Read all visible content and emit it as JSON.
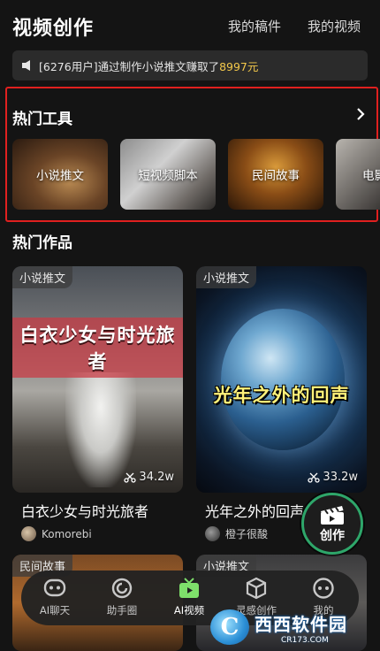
{
  "header": {
    "title": "视频创作",
    "my_drafts": "我的稿件",
    "my_videos": "我的视频"
  },
  "notice": {
    "prefix": "[6276用户]通过制作小说推文赚取了",
    "amount": "8997元"
  },
  "hot_tools": {
    "title": "热门工具",
    "items": [
      {
        "label": "小说推文",
        "icon": "book-image"
      },
      {
        "label": "短视频脚本",
        "icon": "camera-tripod-image"
      },
      {
        "label": "民间故事",
        "icon": "village-image"
      },
      {
        "label": "电影",
        "icon": "film-image"
      }
    ]
  },
  "hot_works": {
    "title": "热门作品",
    "items": [
      {
        "tag": "小说推文",
        "overlay_title": "白衣少女与时光旅者",
        "views": "34.2w",
        "name": "白衣少女与时光旅者",
        "author": "Komorebi"
      },
      {
        "tag": "小说推文",
        "overlay_title": "光年之外的回声",
        "views": "33.2w",
        "name": "光年之外的回声",
        "author": "橙子很酸"
      },
      {
        "tag": "民间故事"
      },
      {
        "tag": "小说推文"
      }
    ]
  },
  "create_button": {
    "label": "创作",
    "icon": "clapperboard-icon"
  },
  "tabbar": [
    {
      "label": "AI聊天",
      "icon": "chat-bot-icon",
      "active": false
    },
    {
      "label": "助手圈",
      "icon": "circle-icon",
      "active": false
    },
    {
      "label": "AI视频",
      "icon": "tv-icon",
      "active": true
    },
    {
      "label": "灵感创作",
      "icon": "cube-icon",
      "active": false
    },
    {
      "label": "我的",
      "icon": "profile-icon",
      "active": false
    }
  ],
  "watermark": {
    "text": "西西软件园",
    "url": "CR173.COM"
  },
  "colors": {
    "background": "#141414",
    "highlight_border": "#e0201f",
    "amount": "#f3c84b",
    "active_tab": "#7ee06b",
    "create_ring": "#2ea66a"
  }
}
